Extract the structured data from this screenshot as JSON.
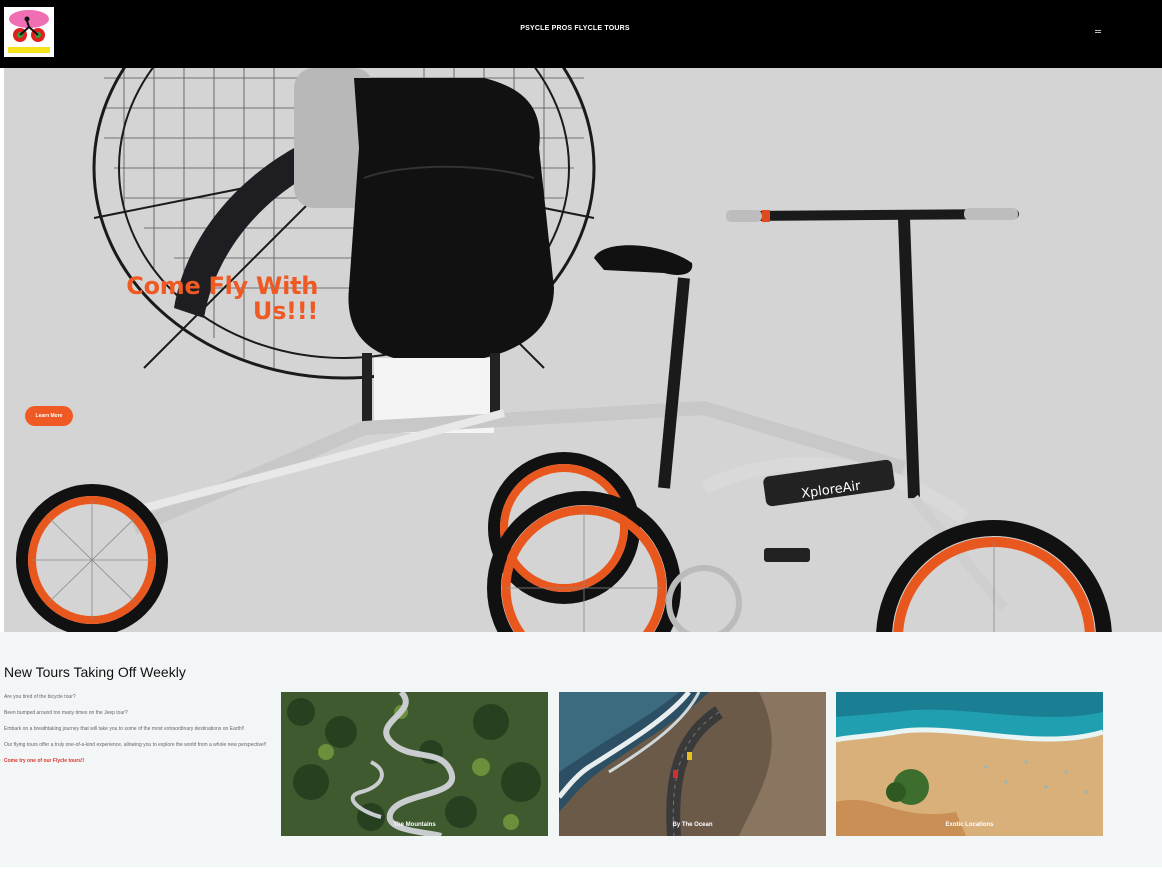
{
  "header": {
    "logo_text": "PSYCLE PROS FLYCLE",
    "site_title": "PSYCLE PROS FLYCLE TOURS",
    "menu_icon": "hamburger-icon"
  },
  "hero": {
    "heading": "Come Fly With Us!!!",
    "button_label": "Learn More",
    "bike_brand": "XploreAir",
    "accent_color": "#ef5a24"
  },
  "tours": {
    "heading": "New Tours Taking Off Weekly",
    "paragraphs": [
      "Are you tired of the bicycle tour?",
      "Been bumped around too many times on the Jeep tour?",
      "Embark on a breathtaking journey that will take you to some of the most extraordinary destinations on Earth!!",
      "Our flying tours offer a truly one-of-a-kind experience, allowing you to explore the world from a whole new perspective!!"
    ],
    "cta": "Come try one of our Flycle tours!!",
    "cards": [
      {
        "label": "The Mountains"
      },
      {
        "label": "By The Ocean"
      },
      {
        "label": "Exotic Locations"
      }
    ]
  }
}
